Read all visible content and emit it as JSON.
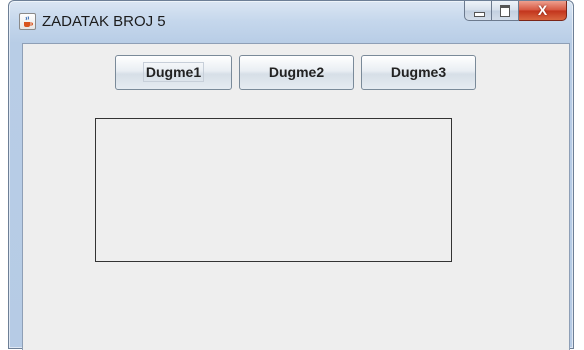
{
  "window": {
    "title": "ZADATAK BROJ 5",
    "app_icon": "java-coffee-icon",
    "controls": {
      "minimize_icon": "minimize-icon",
      "maximize_icon": "maximize-icon",
      "close_glyph": "X"
    }
  },
  "buttons": [
    {
      "label": "Dugme1",
      "focused": true
    },
    {
      "label": "Dugme2",
      "focused": false
    },
    {
      "label": "Dugme3",
      "focused": false
    }
  ],
  "colors": {
    "client_background": "#eeeeee",
    "close_button": "#c2331c",
    "panel_border": "#333333"
  }
}
